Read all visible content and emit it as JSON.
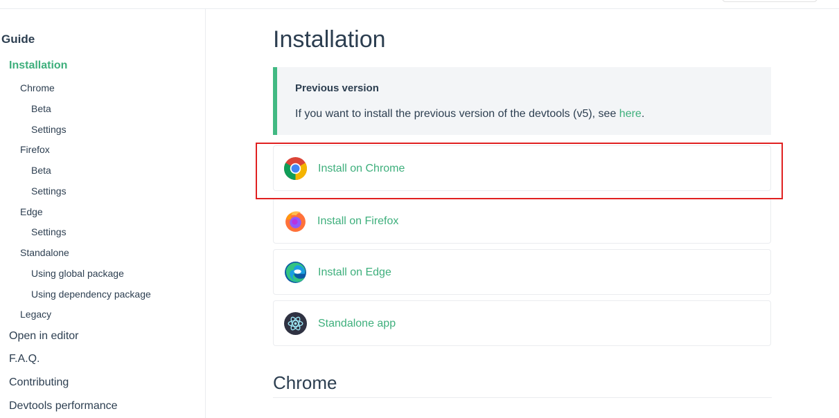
{
  "sidebar": {
    "heading": "Guide",
    "items": [
      {
        "label": "Installation",
        "level": 1,
        "active": true
      },
      {
        "label": "Chrome",
        "level": 2
      },
      {
        "label": "Beta",
        "level": 3
      },
      {
        "label": "Settings",
        "level": 3
      },
      {
        "label": "Firefox",
        "level": 2
      },
      {
        "label": "Beta",
        "level": 3
      },
      {
        "label": "Settings",
        "level": 3
      },
      {
        "label": "Edge",
        "level": 2
      },
      {
        "label": "Settings",
        "level": 3
      },
      {
        "label": "Standalone",
        "level": 2
      },
      {
        "label": "Using global package",
        "level": 3
      },
      {
        "label": "Using dependency package",
        "level": 3
      },
      {
        "label": "Legacy",
        "level": 2
      },
      {
        "label": "Open in editor",
        "level": 1
      },
      {
        "label": "F.A.Q.",
        "level": 1
      },
      {
        "label": "Contributing",
        "level": 1
      },
      {
        "label": "Devtools performance",
        "level": 1
      }
    ]
  },
  "main": {
    "title": "Installation",
    "tip": {
      "title": "Previous version",
      "text_before": "If you want to install the previous version of the devtools (v5), see ",
      "link_label": "here",
      "text_after": "."
    },
    "cards": [
      {
        "label": "Install on Chrome",
        "icon": "chrome-icon"
      },
      {
        "label": "Install on Firefox",
        "icon": "firefox-icon"
      },
      {
        "label": "Install on Edge",
        "icon": "edge-icon"
      },
      {
        "label": "Standalone app",
        "icon": "electron-icon"
      }
    ],
    "section_heading": "Chrome"
  },
  "colors": {
    "accent": "#3eaf7c",
    "tip_border": "#42b983",
    "highlight": "#e02020",
    "text": "#2c3e50"
  }
}
